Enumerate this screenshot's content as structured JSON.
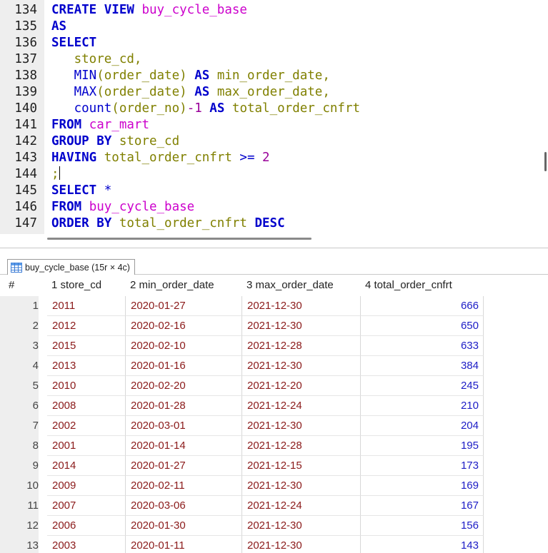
{
  "editor": {
    "lines": [
      {
        "ln": "134",
        "tokens": [
          {
            "t": "CREATE VIEW ",
            "c": "kw"
          },
          {
            "t": "buy_cycle_base",
            "c": "obj"
          }
        ]
      },
      {
        "ln": "135",
        "tokens": [
          {
            "t": "AS",
            "c": "kw"
          }
        ]
      },
      {
        "ln": "136",
        "tokens": [
          {
            "t": "SELECT",
            "c": "kw"
          }
        ]
      },
      {
        "ln": "137",
        "tokens": [
          {
            "t": "   ",
            "c": "plain"
          },
          {
            "t": "store_cd",
            "c": "col"
          },
          {
            "t": ",",
            "c": "col"
          }
        ]
      },
      {
        "ln": "138",
        "tokens": [
          {
            "t": "   ",
            "c": "plain"
          },
          {
            "t": "MIN",
            "c": "fn"
          },
          {
            "t": "(",
            "c": "col"
          },
          {
            "t": "order_date",
            "c": "col"
          },
          {
            "t": ") ",
            "c": "col"
          },
          {
            "t": "AS ",
            "c": "kw"
          },
          {
            "t": "min_order_date",
            "c": "col"
          },
          {
            "t": ",",
            "c": "col"
          }
        ]
      },
      {
        "ln": "139",
        "tokens": [
          {
            "t": "   ",
            "c": "plain"
          },
          {
            "t": "MAX",
            "c": "fn"
          },
          {
            "t": "(",
            "c": "col"
          },
          {
            "t": "order_date",
            "c": "col"
          },
          {
            "t": ") ",
            "c": "col"
          },
          {
            "t": "AS ",
            "c": "kw"
          },
          {
            "t": "max_order_date",
            "c": "col"
          },
          {
            "t": ",",
            "c": "col"
          }
        ]
      },
      {
        "ln": "140",
        "tokens": [
          {
            "t": "   ",
            "c": "plain"
          },
          {
            "t": "count",
            "c": "fn"
          },
          {
            "t": "(",
            "c": "col"
          },
          {
            "t": "order_no",
            "c": "col"
          },
          {
            "t": ")",
            "c": "col"
          },
          {
            "t": "-1 ",
            "c": "num"
          },
          {
            "t": "AS ",
            "c": "kw"
          },
          {
            "t": "total_order_cnfrt",
            "c": "col"
          }
        ]
      },
      {
        "ln": "141",
        "tokens": [
          {
            "t": "FROM ",
            "c": "kw"
          },
          {
            "t": "car_mart",
            "c": "obj"
          }
        ]
      },
      {
        "ln": "142",
        "tokens": [
          {
            "t": "GROUP BY ",
            "c": "kw"
          },
          {
            "t": "store_cd",
            "c": "col"
          }
        ]
      },
      {
        "ln": "143",
        "tokens": [
          {
            "t": "HAVING ",
            "c": "kw"
          },
          {
            "t": "total_order_cnfrt ",
            "c": "col"
          },
          {
            "t": ">= ",
            "c": "fn"
          },
          {
            "t": "2",
            "c": "num"
          }
        ]
      },
      {
        "ln": "144",
        "tokens": [
          {
            "t": ";",
            "c": "col"
          }
        ],
        "caret": true
      },
      {
        "ln": "145",
        "tokens": [
          {
            "t": "SELECT ",
            "c": "kw"
          },
          {
            "t": "*",
            "c": "fn"
          }
        ]
      },
      {
        "ln": "146",
        "tokens": [
          {
            "t": "FROM ",
            "c": "kw"
          },
          {
            "t": "buy_cycle_base",
            "c": "obj"
          }
        ]
      },
      {
        "ln": "147",
        "tokens": [
          {
            "t": "ORDER BY ",
            "c": "kw"
          },
          {
            "t": "total_order_cnfrt ",
            "c": "col"
          },
          {
            "t": "DESC",
            "c": "kw"
          }
        ]
      }
    ]
  },
  "result": {
    "tab_label": "buy_cycle_base (15r × 4c)",
    "grid_icon": "table-grid-icon",
    "columns": [
      "#",
      "1 store_cd",
      "2 min_order_date",
      "3 max_order_date",
      "4 total_order_cnfrt"
    ],
    "rows": [
      [
        "1",
        "2011",
        "2020-01-27",
        "2021-12-30",
        "666"
      ],
      [
        "2",
        "2012",
        "2020-02-16",
        "2021-12-30",
        "650"
      ],
      [
        "3",
        "2015",
        "2020-02-10",
        "2021-12-28",
        "633"
      ],
      [
        "4",
        "2013",
        "2020-01-16",
        "2021-12-30",
        "384"
      ],
      [
        "5",
        "2010",
        "2020-02-20",
        "2021-12-20",
        "245"
      ],
      [
        "6",
        "2008",
        "2020-01-28",
        "2021-12-24",
        "210"
      ],
      [
        "7",
        "2002",
        "2020-03-01",
        "2021-12-30",
        "204"
      ],
      [
        "8",
        "2001",
        "2020-01-14",
        "2021-12-28",
        "195"
      ],
      [
        "9",
        "2014",
        "2020-01-27",
        "2021-12-15",
        "173"
      ],
      [
        "10",
        "2009",
        "2020-02-11",
        "2021-12-30",
        "169"
      ],
      [
        "11",
        "2007",
        "2020-03-06",
        "2021-12-24",
        "167"
      ],
      [
        "12",
        "2006",
        "2020-01-30",
        "2021-12-30",
        "156"
      ],
      [
        "13",
        "2003",
        "2020-01-11",
        "2021-12-30",
        "143"
      ]
    ]
  }
}
